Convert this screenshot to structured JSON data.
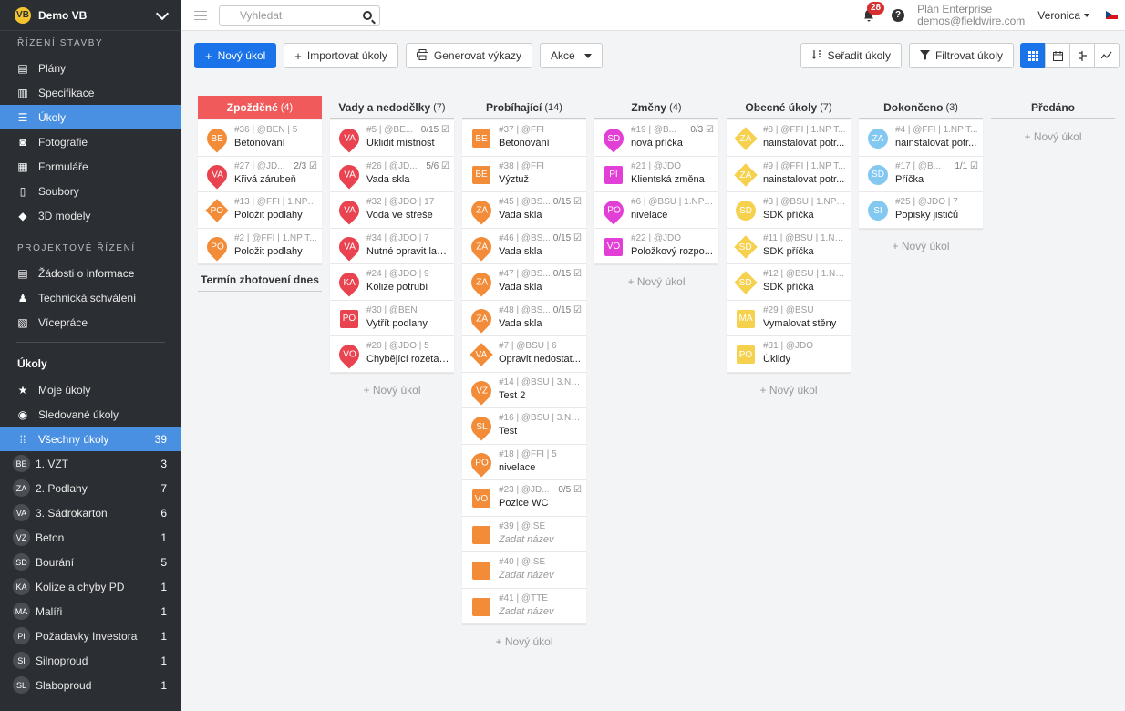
{
  "sidebar": {
    "logo": "VB",
    "project": "Demo VB",
    "sections": [
      {
        "title": "ŘÍZENÍ STAVBY",
        "items": [
          {
            "label": "Plány",
            "icon": "map-icon"
          },
          {
            "label": "Specifikace",
            "icon": "book-icon"
          },
          {
            "label": "Úkoly",
            "icon": "list-icon",
            "active": true
          },
          {
            "label": "Fotografie",
            "icon": "camera-icon"
          },
          {
            "label": "Formuláře",
            "icon": "clipboard-icon"
          },
          {
            "label": "Soubory",
            "icon": "file-icon"
          },
          {
            "label": "3D modely",
            "icon": "cube-icon"
          }
        ]
      },
      {
        "title": "PROJEKTOVÉ ŘÍZENÍ",
        "items": [
          {
            "label": "Žádosti o informace",
            "icon": "document-icon"
          },
          {
            "label": "Technická schválení",
            "icon": "stamp-icon"
          },
          {
            "label": "Vícepráce",
            "icon": "dollar-document-icon"
          }
        ]
      }
    ],
    "tasks_header": "Úkoly",
    "task_items": [
      {
        "label": "Moje úkoly",
        "icon": "star-icon"
      },
      {
        "label": "Sledované úkoly",
        "icon": "eye-icon"
      },
      {
        "label": "Všechny úkoly",
        "icon": "grid-icon",
        "count": "39",
        "active": true
      }
    ],
    "categories": [
      {
        "abbr": "BE",
        "label": "1. VZT",
        "count": "3"
      },
      {
        "abbr": "ZA",
        "label": "2. Podlahy",
        "count": "7"
      },
      {
        "abbr": "VA",
        "label": "3. Sádrokarton",
        "count": "6"
      },
      {
        "abbr": "VZ",
        "label": "Beton",
        "count": "1"
      },
      {
        "abbr": "SD",
        "label": "Bourání",
        "count": "5"
      },
      {
        "abbr": "KA",
        "label": "Kolize a chyby PD",
        "count": "1"
      },
      {
        "abbr": "MA",
        "label": "Malíři",
        "count": "1"
      },
      {
        "abbr": "PI",
        "label": "Požadavky Investora",
        "count": "1"
      },
      {
        "abbr": "SI",
        "label": "Silnoproud",
        "count": "1"
      },
      {
        "abbr": "SL",
        "label": "Slaboproud",
        "count": "1"
      }
    ]
  },
  "topbar": {
    "search_placeholder": "Vyhledat",
    "notifications": "28",
    "help": "?",
    "plan": "Plán Enterprise",
    "email": "demos@fieldwire.com",
    "user": "Veronica"
  },
  "toolbar": {
    "new_task": "Nový úkol",
    "import": "Importovat úkoly",
    "reports": "Generovat výkazy",
    "actions": "Akce",
    "sort": "Seřadit úkoly",
    "filter": "Filtrovat úkoly"
  },
  "colors": {
    "accent": "#1a73e8",
    "overdue": "#f05a5a",
    "orange": "#f28c38",
    "red": "#e8434f",
    "magenta": "#e23fd6",
    "yellow": "#f5d14e",
    "blue": "#82c8f0"
  },
  "add_label": "+ Nový úkol",
  "termin_label": "Termín zhotovení dnes",
  "columns": [
    {
      "title": "Zpožděné",
      "count": "(4)",
      "overdue": true,
      "cards": [
        {
          "meta": "#36 | @BEN | 5",
          "check": "",
          "title": "Betonování",
          "abbr": "BE",
          "shape": "pin",
          "color": "#f28c38"
        },
        {
          "meta": "#27 | @JD...",
          "check": "2/3",
          "title": "Křivá zárubeň",
          "abbr": "VA",
          "shape": "pin",
          "color": "#e8434f"
        },
        {
          "meta": "#13 | @FFI | 1.NP ...",
          "check": "",
          "title": "Položit podlahy",
          "abbr": "PO",
          "shape": "dia",
          "color": "#f28c38"
        },
        {
          "meta": "#2 | @FFI | 1.NP T...",
          "check": "",
          "title": "Položit podlahy",
          "abbr": "PO",
          "shape": "pin",
          "color": "#f28c38"
        }
      ]
    },
    {
      "title": "Vady a nedodělky",
      "count": "(7)",
      "cards": [
        {
          "meta": "#5 | @BE...",
          "check": "0/15",
          "title": "Uklidit místnost",
          "abbr": "VA",
          "shape": "pin",
          "color": "#e8434f"
        },
        {
          "meta": "#26 | @JD...",
          "check": "5/6",
          "title": "Vada skla",
          "abbr": "VA",
          "shape": "pin",
          "color": "#e8434f"
        },
        {
          "meta": "#32 | @JDO | 17",
          "check": "",
          "title": "Voda ve střeše",
          "abbr": "VA",
          "shape": "pin",
          "color": "#e8434f"
        },
        {
          "meta": "#34 | @JDO | 7",
          "check": "",
          "title": "Nutné opravit lak...",
          "abbr": "VA",
          "shape": "pin",
          "color": "#e8434f"
        },
        {
          "meta": "#24 | @JDO | 9",
          "check": "",
          "title": "Kolize potrubí",
          "abbr": "KA",
          "shape": "pin",
          "color": "#e8434f"
        },
        {
          "meta": "#30 | @BEN",
          "check": "",
          "title": "Vytřít podlahy",
          "abbr": "PO",
          "shape": "sq",
          "color": "#e8434f"
        },
        {
          "meta": "#20 | @JDO | 5",
          "check": "",
          "title": "Chybějící rozeta ...",
          "abbr": "VO",
          "shape": "pin",
          "color": "#e8434f"
        }
      ]
    },
    {
      "title": "Probíhající",
      "count": "(14)",
      "cards": [
        {
          "meta": "#37 | @FFI",
          "check": "",
          "title": "Betonování",
          "abbr": "BE",
          "shape": "sq",
          "color": "#f28c38"
        },
        {
          "meta": "#38 | @FFI",
          "check": "",
          "title": "Výztuž",
          "abbr": "BE",
          "shape": "sq",
          "color": "#f28c38"
        },
        {
          "meta": "#45 | @BS...",
          "check": "0/15",
          "title": "Vada skla",
          "abbr": "ZA",
          "shape": "pin",
          "color": "#f28c38"
        },
        {
          "meta": "#46 | @BS...",
          "check": "0/15",
          "title": "Vada skla",
          "abbr": "ZA",
          "shape": "pin",
          "color": "#f28c38"
        },
        {
          "meta": "#47 | @BS...",
          "check": "0/15",
          "title": "Vada skla",
          "abbr": "ZA",
          "shape": "pin",
          "color": "#f28c38"
        },
        {
          "meta": "#48 | @BS...",
          "check": "0/15",
          "title": "Vada skla",
          "abbr": "ZA",
          "shape": "pin",
          "color": "#f28c38"
        },
        {
          "meta": "#7 | @BSU | 6",
          "check": "",
          "title": "Opravit nedostat...",
          "abbr": "VA",
          "shape": "dia",
          "color": "#f28c38"
        },
        {
          "meta": "#14 | @BSU | 3.NP ...",
          "check": "",
          "title": "Test 2",
          "abbr": "VZ",
          "shape": "pin",
          "color": "#f28c38"
        },
        {
          "meta": "#16 | @BSU | 3.NP ...",
          "check": "",
          "title": "Test",
          "abbr": "SL",
          "shape": "pin",
          "color": "#f28c38"
        },
        {
          "meta": "#18 | @FFI | 5",
          "check": "",
          "title": "nivelace",
          "abbr": "PO",
          "shape": "pin",
          "color": "#f28c38"
        },
        {
          "meta": "#23 | @JD...",
          "check": "0/5",
          "title": "Pozice WC",
          "abbr": "VO",
          "shape": "sq",
          "color": "#f28c38"
        },
        {
          "meta": "#39 | @ISE",
          "check": "",
          "title": "Zadat název",
          "placeholder": true,
          "abbr": "",
          "shape": "sq",
          "color": "#f28c38"
        },
        {
          "meta": "#40 | @ISE",
          "check": "",
          "title": "Zadat název",
          "placeholder": true,
          "abbr": "",
          "shape": "sq",
          "color": "#f28c38"
        },
        {
          "meta": "#41 | @TTE",
          "check": "",
          "title": "Zadat název",
          "placeholder": true,
          "abbr": "",
          "shape": "sq",
          "color": "#f28c38"
        }
      ]
    },
    {
      "title": "Změny",
      "count": "(4)",
      "cards": [
        {
          "meta": "#19 | @B...",
          "check": "0/3",
          "title": "nová příčka",
          "abbr": "SD",
          "shape": "pin",
          "color": "#e23fd6"
        },
        {
          "meta": "#21 | @JDO",
          "check": "",
          "title": "Klientská změna",
          "abbr": "PI",
          "shape": "sq",
          "color": "#e23fd6"
        },
        {
          "meta": "#6 | @BSU | 1.NP T...",
          "check": "",
          "title": "nivelace",
          "abbr": "PO",
          "shape": "pin",
          "color": "#e23fd6"
        },
        {
          "meta": "#22 | @JDO",
          "check": "",
          "title": "Položkový rozpo...",
          "abbr": "VO",
          "shape": "sq",
          "color": "#e23fd6"
        }
      ]
    },
    {
      "title": "Obecné úkoly",
      "count": "(7)",
      "cards": [
        {
          "meta": "#8 | @FFI | 1.NP T...",
          "check": "",
          "title": "nainstalovat potr...",
          "abbr": "ZA",
          "shape": "dia",
          "color": "#f5d14e"
        },
        {
          "meta": "#9 | @FFI | 1.NP T...",
          "check": "",
          "title": "nainstalovat potr...",
          "abbr": "ZA",
          "shape": "dia",
          "color": "#f5d14e"
        },
        {
          "meta": "#3 | @BSU | 1.NP T...",
          "check": "",
          "title": "SDK příčka",
          "abbr": "SD",
          "shape": "circ",
          "color": "#f5d14e"
        },
        {
          "meta": "#11 | @BSU | 1.NP ...",
          "check": "",
          "title": "SDK příčka",
          "abbr": "SD",
          "shape": "dia",
          "color": "#f5d14e"
        },
        {
          "meta": "#12 | @BSU | 1.NP ...",
          "check": "",
          "title": "SDK příčka",
          "abbr": "SD",
          "shape": "dia",
          "color": "#f5d14e"
        },
        {
          "meta": "#29 | @BSU",
          "check": "",
          "title": "Vymalovat stěny",
          "abbr": "MA",
          "shape": "sq",
          "color": "#f5d14e"
        },
        {
          "meta": "#31 | @JDO",
          "check": "",
          "title": "Úklidy",
          "abbr": "PO",
          "shape": "sq",
          "color": "#f5d14e"
        }
      ]
    },
    {
      "title": "Dokončeno",
      "count": "(3)",
      "cards": [
        {
          "meta": "#4 | @FFI | 1.NP T...",
          "check": "",
          "title": "nainstalovat potr...",
          "abbr": "ZA",
          "shape": "circ",
          "color": "#82c8f0"
        },
        {
          "meta": "#17 | @B...",
          "check": "1/1",
          "title": "Příčka",
          "abbr": "SD",
          "shape": "circ",
          "color": "#82c8f0"
        },
        {
          "meta": "#25 | @JDO | 7",
          "check": "",
          "title": "Popisky jističů",
          "abbr": "SI",
          "shape": "circ",
          "color": "#82c8f0"
        }
      ]
    },
    {
      "title": "Předáno",
      "count": "",
      "cards": []
    }
  ]
}
